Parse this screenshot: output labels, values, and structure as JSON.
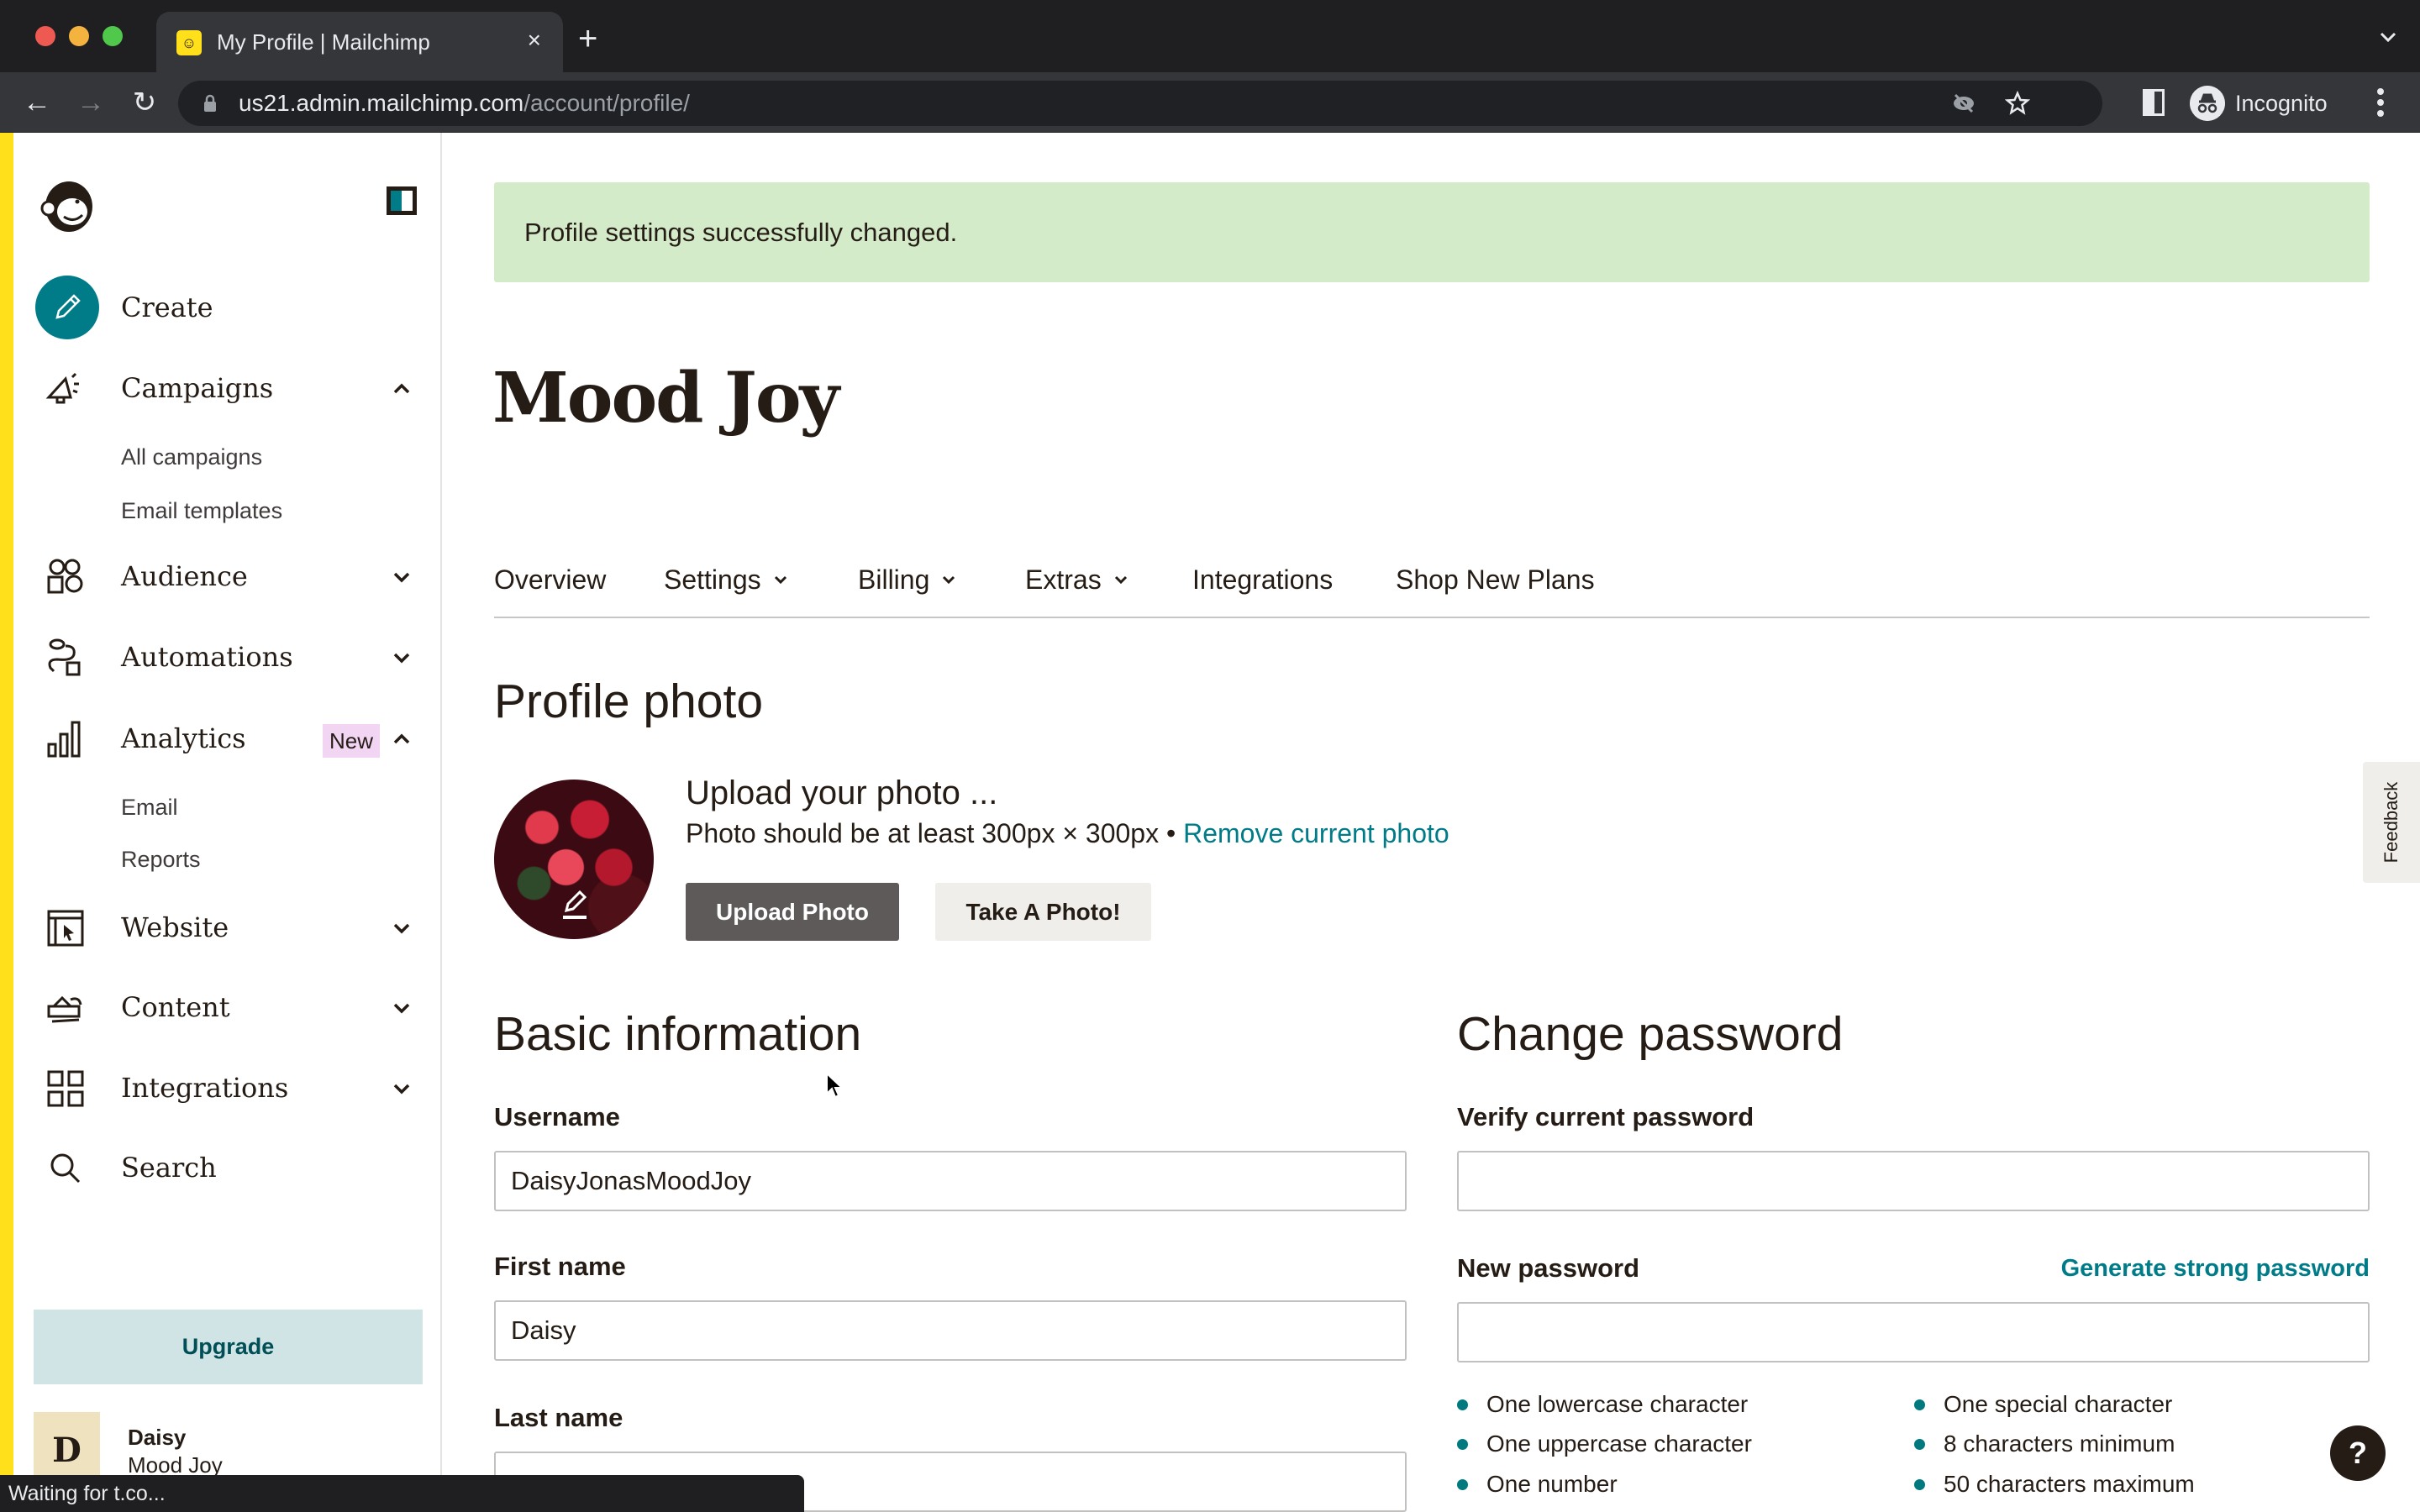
{
  "browser": {
    "tab_title": "My Profile | Mailchimp",
    "tab_close": "×",
    "new_tab": "+",
    "url_host": "us21.admin.mailchimp.com",
    "url_path": "/account/profile/",
    "profile_label": "Incognito",
    "status_text": "Waiting for t.co..."
  },
  "sidebar": {
    "create_label": "Create",
    "items": [
      {
        "label": "Campaigns",
        "icon": "megaphone-icon",
        "expanded": true,
        "children": [
          "All campaigns",
          "Email templates"
        ]
      },
      {
        "label": "Audience",
        "icon": "audience-icon",
        "expanded": false
      },
      {
        "label": "Automations",
        "icon": "automations-icon",
        "expanded": false
      },
      {
        "label": "Analytics",
        "icon": "analytics-icon",
        "expanded": true,
        "badge": "New",
        "children": [
          "Email",
          "Reports"
        ]
      },
      {
        "label": "Website",
        "icon": "website-icon",
        "expanded": false
      },
      {
        "label": "Content",
        "icon": "content-icon",
        "expanded": false
      },
      {
        "label": "Integrations",
        "icon": "integrations-icon",
        "expanded": false
      },
      {
        "label": "Search",
        "icon": "search-icon"
      }
    ],
    "upgrade_label": "Upgrade",
    "account": {
      "initial": "D",
      "name": "Daisy",
      "org": "Mood Joy"
    }
  },
  "main": {
    "banner_text": "Profile settings successfully changed.",
    "title": "Mood Joy",
    "subnav": [
      {
        "label": "Overview",
        "has_dropdown": false
      },
      {
        "label": "Settings",
        "has_dropdown": true
      },
      {
        "label": "Billing",
        "has_dropdown": true
      },
      {
        "label": "Extras",
        "has_dropdown": true
      },
      {
        "label": "Integrations",
        "has_dropdown": false
      },
      {
        "label": "Shop New Plans",
        "has_dropdown": false
      }
    ],
    "profile_photo": {
      "heading": "Profile photo",
      "upload_title": "Upload your photo ...",
      "hint": "Photo should be at least 300px × 300px • ",
      "remove_link": "Remove current photo",
      "upload_button": "Upload Photo",
      "take_button": "Take A Photo!"
    },
    "basic_info": {
      "heading": "Basic information",
      "username_label": "Username",
      "username_value": "DaisyJonasMoodJoy",
      "first_name_label": "First name",
      "first_name_value": "Daisy",
      "last_name_label": "Last name",
      "last_name_value": ""
    },
    "change_password": {
      "heading": "Change password",
      "current_label": "Verify current password",
      "current_value": "",
      "new_label": "New password",
      "new_value": "",
      "generate_link": "Generate strong password",
      "requirements": [
        "One lowercase character",
        "One uppercase character",
        "One number",
        "One special character",
        "8 characters minimum",
        "50 characters maximum"
      ]
    },
    "feedback_label": "Feedback",
    "help_label": "?"
  },
  "colors": {
    "brand_yellow": "#ffe01b",
    "accent_teal": "#007c89",
    "success_banner": "#d4ebc9",
    "new_badge": "#f1d5f3",
    "upgrade_bg": "#d0e3e5"
  }
}
